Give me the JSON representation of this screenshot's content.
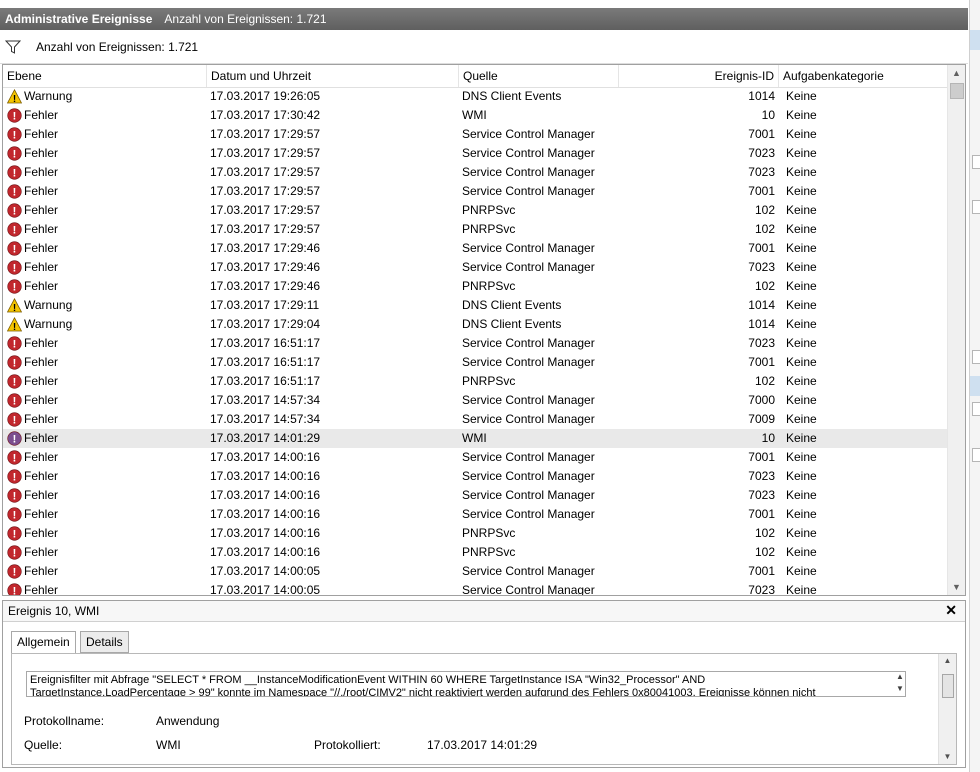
{
  "title_bar": {
    "title": "Administrative Ereignisse",
    "count": "Anzahl von Ereignissen: 1.721"
  },
  "filter_bar": {
    "icon": "filter-icon",
    "count": "Anzahl von Ereignissen: 1.721"
  },
  "columns": {
    "level": "Ebene",
    "date": "Datum und Uhrzeit",
    "source": "Quelle",
    "id": "Ereignis-ID",
    "category": "Aufgabenkategorie"
  },
  "events": [
    {
      "level": "Warnung",
      "type": "warning",
      "date": "17.03.2017 19:26:05",
      "source": "DNS Client Events",
      "id": "1014",
      "category": "Keine"
    },
    {
      "level": "Fehler",
      "type": "error",
      "date": "17.03.2017 17:30:42",
      "source": "WMI",
      "id": "10",
      "category": "Keine"
    },
    {
      "level": "Fehler",
      "type": "error",
      "date": "17.03.2017 17:29:57",
      "source": "Service Control Manager",
      "id": "7001",
      "category": "Keine"
    },
    {
      "level": "Fehler",
      "type": "error",
      "date": "17.03.2017 17:29:57",
      "source": "Service Control Manager",
      "id": "7023",
      "category": "Keine"
    },
    {
      "level": "Fehler",
      "type": "error",
      "date": "17.03.2017 17:29:57",
      "source": "Service Control Manager",
      "id": "7023",
      "category": "Keine"
    },
    {
      "level": "Fehler",
      "type": "error",
      "date": "17.03.2017 17:29:57",
      "source": "Service Control Manager",
      "id": "7001",
      "category": "Keine"
    },
    {
      "level": "Fehler",
      "type": "error",
      "date": "17.03.2017 17:29:57",
      "source": "PNRPSvc",
      "id": "102",
      "category": "Keine"
    },
    {
      "level": "Fehler",
      "type": "error",
      "date": "17.03.2017 17:29:57",
      "source": "PNRPSvc",
      "id": "102",
      "category": "Keine"
    },
    {
      "level": "Fehler",
      "type": "error",
      "date": "17.03.2017 17:29:46",
      "source": "Service Control Manager",
      "id": "7001",
      "category": "Keine"
    },
    {
      "level": "Fehler",
      "type": "error",
      "date": "17.03.2017 17:29:46",
      "source": "Service Control Manager",
      "id": "7023",
      "category": "Keine"
    },
    {
      "level": "Fehler",
      "type": "error",
      "date": "17.03.2017 17:29:46",
      "source": "PNRPSvc",
      "id": "102",
      "category": "Keine"
    },
    {
      "level": "Warnung",
      "type": "warning",
      "date": "17.03.2017 17:29:11",
      "source": "DNS Client Events",
      "id": "1014",
      "category": "Keine"
    },
    {
      "level": "Warnung",
      "type": "warning",
      "date": "17.03.2017 17:29:04",
      "source": "DNS Client Events",
      "id": "1014",
      "category": "Keine"
    },
    {
      "level": "Fehler",
      "type": "error",
      "date": "17.03.2017 16:51:17",
      "source": "Service Control Manager",
      "id": "7023",
      "category": "Keine"
    },
    {
      "level": "Fehler",
      "type": "error",
      "date": "17.03.2017 16:51:17",
      "source": "Service Control Manager",
      "id": "7001",
      "category": "Keine"
    },
    {
      "level": "Fehler",
      "type": "error",
      "date": "17.03.2017 16:51:17",
      "source": "PNRPSvc",
      "id": "102",
      "category": "Keine"
    },
    {
      "level": "Fehler",
      "type": "error",
      "date": "17.03.2017 14:57:34",
      "source": "Service Control Manager",
      "id": "7000",
      "category": "Keine"
    },
    {
      "level": "Fehler",
      "type": "error",
      "date": "17.03.2017 14:57:34",
      "source": "Service Control Manager",
      "id": "7009",
      "category": "Keine"
    },
    {
      "level": "Fehler",
      "type": "error-selected",
      "date": "17.03.2017 14:01:29",
      "source": "WMI",
      "id": "10",
      "category": "Keine",
      "selected": true
    },
    {
      "level": "Fehler",
      "type": "error",
      "date": "17.03.2017 14:00:16",
      "source": "Service Control Manager",
      "id": "7001",
      "category": "Keine"
    },
    {
      "level": "Fehler",
      "type": "error",
      "date": "17.03.2017 14:00:16",
      "source": "Service Control Manager",
      "id": "7023",
      "category": "Keine"
    },
    {
      "level": "Fehler",
      "type": "error",
      "date": "17.03.2017 14:00:16",
      "source": "Service Control Manager",
      "id": "7023",
      "category": "Keine"
    },
    {
      "level": "Fehler",
      "type": "error",
      "date": "17.03.2017 14:00:16",
      "source": "Service Control Manager",
      "id": "7001",
      "category": "Keine"
    },
    {
      "level": "Fehler",
      "type": "error",
      "date": "17.03.2017 14:00:16",
      "source": "PNRPSvc",
      "id": "102",
      "category": "Keine"
    },
    {
      "level": "Fehler",
      "type": "error",
      "date": "17.03.2017 14:00:16",
      "source": "PNRPSvc",
      "id": "102",
      "category": "Keine"
    },
    {
      "level": "Fehler",
      "type": "error",
      "date": "17.03.2017 14:00:05",
      "source": "Service Control Manager",
      "id": "7001",
      "category": "Keine"
    },
    {
      "level": "Fehler",
      "type": "error",
      "date": "17.03.2017 14:00:05",
      "source": "Service Control Manager",
      "id": "7023",
      "category": "Keine"
    }
  ],
  "detail": {
    "title": "Ereignis 10, WMI",
    "close": "✕",
    "tabs": [
      "Allgemein",
      "Details"
    ],
    "description_line1": "Ereignisfilter mit Abfrage \"SELECT * FROM __InstanceModificationEvent WITHIN 60 WHERE TargetInstance ISA \"Win32_Processor\" AND",
    "description_line2": "TargetInstance.LoadPercentage > 99\" konnte im Namespace \"//./root/CIMV2\" nicht reaktiviert werden aufgrund des Fehlers 0x80041003. Ereignisse können nicht",
    "log_name_label": "Protokollname:",
    "log_name_value": "Anwendung",
    "source_label": "Quelle:",
    "source_value": "WMI",
    "logged_label": "Protokolliert:",
    "logged_value": "17.03.2017 14:01:29"
  },
  "colors": {
    "title_bar": "#6b6b6b",
    "selected_row": "#e9e9e9",
    "error_red": "#c1272d",
    "warning_yellow": "#f4c400"
  }
}
